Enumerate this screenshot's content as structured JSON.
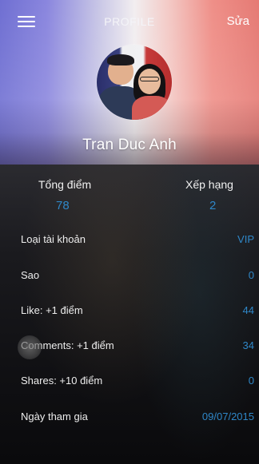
{
  "header": {
    "title": "PROFILE",
    "edit_label": "Sửa",
    "menu_icon": "hamburger-menu-icon"
  },
  "profile": {
    "name": "Tran Duc Anh"
  },
  "stats": {
    "total_label": "Tổng điểm",
    "total_value": "78",
    "rank_label": "Xếp hạng",
    "rank_value": "2"
  },
  "details": [
    {
      "label": "Loại tài khoản",
      "value": "VIP"
    },
    {
      "label": "Sao",
      "value": "0"
    },
    {
      "label": "Like: +1 điểm",
      "value": "44"
    },
    {
      "label": "Comments: +1 điểm",
      "value": "34"
    },
    {
      "label": "Shares: +10 điểm",
      "value": "0"
    },
    {
      "label": "Ngày tham gia",
      "value": "09/07/2015"
    }
  ],
  "colors": {
    "accent_value": "#2f87c8",
    "header_left": "#6f6fd2",
    "header_right": "#e57a74",
    "background": "#101013"
  }
}
